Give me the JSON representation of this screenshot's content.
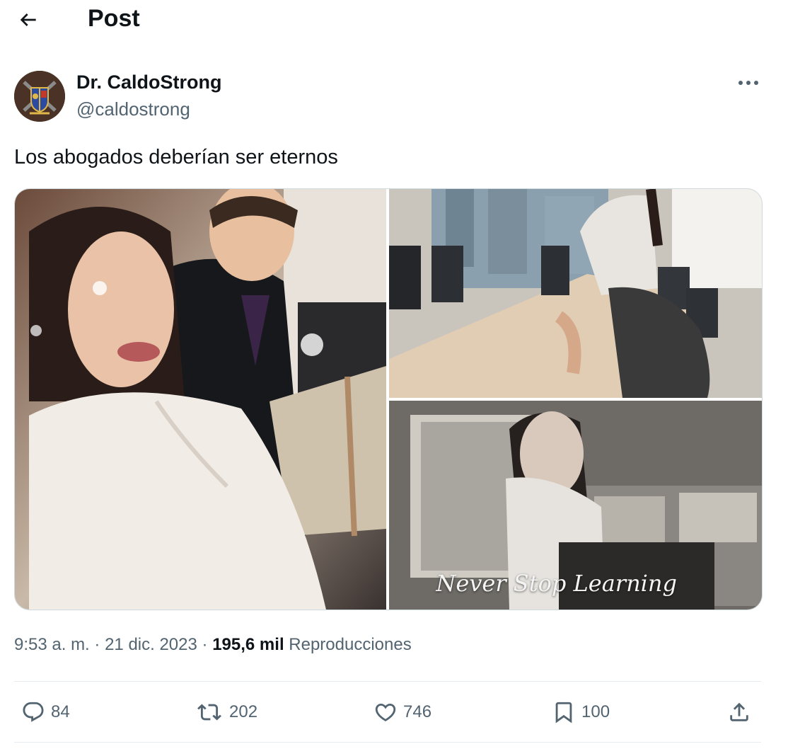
{
  "header": {
    "title": "Post",
    "back_icon": "arrow-left-icon"
  },
  "author": {
    "name": "Dr. CaldoStrong",
    "handle": "@caldostrong",
    "avatar_icon": "crest-avatar"
  },
  "more_icon": "more-horizontal-icon",
  "tweet": {
    "text": "Los abogados deberían ser eternos"
  },
  "media": {
    "overlay_text": "Never Stop Learning"
  },
  "meta": {
    "time": "9:53 a. m.",
    "separator": "·",
    "date": "21 dic. 2023",
    "views": "195,6 mil",
    "views_label": "Reproducciones"
  },
  "actions": {
    "replies": "84",
    "reposts": "202",
    "likes": "746",
    "bookmarks": "100"
  },
  "colors": {
    "text": "#0f1419",
    "secondary": "#536471",
    "border": "#cfd9de"
  }
}
